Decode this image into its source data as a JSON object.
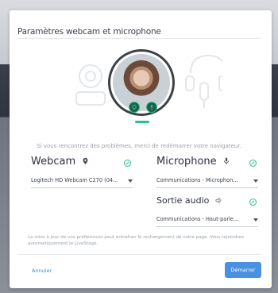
{
  "modal": {
    "title": "Paramètres webcam et microphone",
    "notice": "Si vous rencontrez des problèmes, merci de redémarrer votre navigateur.",
    "hint": "La mise à jour de vos préférences peut entraîner le rechargement de votre page. Vous rejoindrez automatiquement le LiveStage.",
    "cancel_label": "Annuler",
    "start_label": "Démarrer"
  },
  "webcam": {
    "title": "Webcam",
    "selected": "Logitech HD Webcam C270 (04..."
  },
  "microphone": {
    "title": "Microphone",
    "selected": "Communications - Microphon..."
  },
  "audio": {
    "title": "Sortie audio",
    "selected": "Communications - Haut-parle..."
  },
  "colors": {
    "accent": "#4a90e2",
    "ok": "#2bc08c"
  }
}
